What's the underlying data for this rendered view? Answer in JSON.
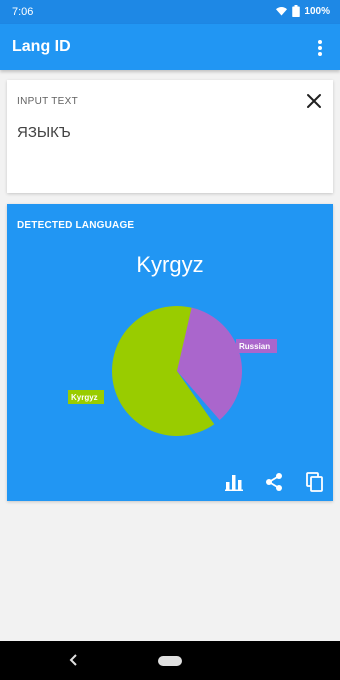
{
  "status": {
    "time": "7:06",
    "battery": "100%"
  },
  "appbar": {
    "title": "Lang ID"
  },
  "input": {
    "label": "INPUT TEXT",
    "value": "ЯЗЫКЪ"
  },
  "result": {
    "label": "DETECTED LANGUAGE",
    "language": "Kyrgyz"
  },
  "colors": {
    "primary": "#2196f3",
    "status": "#1e88e5",
    "kyrgyz": "#99cc00",
    "russian": "#aa66cc"
  },
  "chart_data": {
    "type": "pie",
    "categories": [
      "Kyrgyz",
      "Russian"
    ],
    "values": [
      0.65,
      0.35
    ],
    "colors": [
      "#99cc00",
      "#aa66cc"
    ]
  },
  "icons": [
    "wifi-icon",
    "signal-icon",
    "battery-icon",
    "more-vert-icon",
    "close-icon",
    "bar-chart-icon",
    "share-icon",
    "copy-icon",
    "back-icon",
    "home-icon"
  ]
}
